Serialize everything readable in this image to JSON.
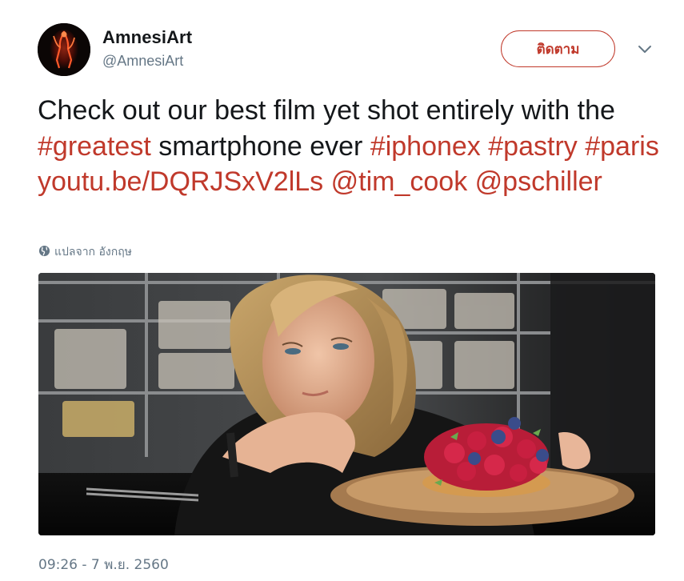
{
  "author": {
    "display_name": "AmnesiArt",
    "screen_name": "@AmnesiArt",
    "avatar_icon": "avatar-red-figure"
  },
  "follow_button": {
    "label": "ติดตาม"
  },
  "menu_icon": "chevron-down-icon",
  "tweet": {
    "segments": [
      {
        "text": "Check out our best film yet shot entirely with the ",
        "type": "text"
      },
      {
        "text": "#greatest",
        "type": "hashtag"
      },
      {
        "text": " smartphone ever ",
        "type": "text"
      },
      {
        "text": "#iphonex",
        "type": "hashtag"
      },
      {
        "text": " ",
        "type": "text"
      },
      {
        "text": "#pastry",
        "type": "hashtag"
      },
      {
        "text": " ",
        "type": "text"
      },
      {
        "text": "#paris",
        "type": "hashtag"
      },
      {
        "text": " ",
        "type": "text"
      },
      {
        "text": "youtu.be/DQRJSxV2lLs",
        "type": "url"
      },
      {
        "text": " ",
        "type": "text"
      },
      {
        "text": "@tim_cook",
        "type": "mention"
      },
      {
        "text": " ",
        "type": "text"
      },
      {
        "text": "@pschiller",
        "type": "mention"
      }
    ]
  },
  "translate": {
    "icon": "globe-icon",
    "label": "แปลจาก อังกฤษ"
  },
  "media": {
    "icon": "photo-woman-pastry"
  },
  "timestamp": "09:26 - 7 พ.ย. 2560",
  "colors": {
    "link": "#c0392b",
    "text": "#14171a",
    "muted": "#657786"
  }
}
